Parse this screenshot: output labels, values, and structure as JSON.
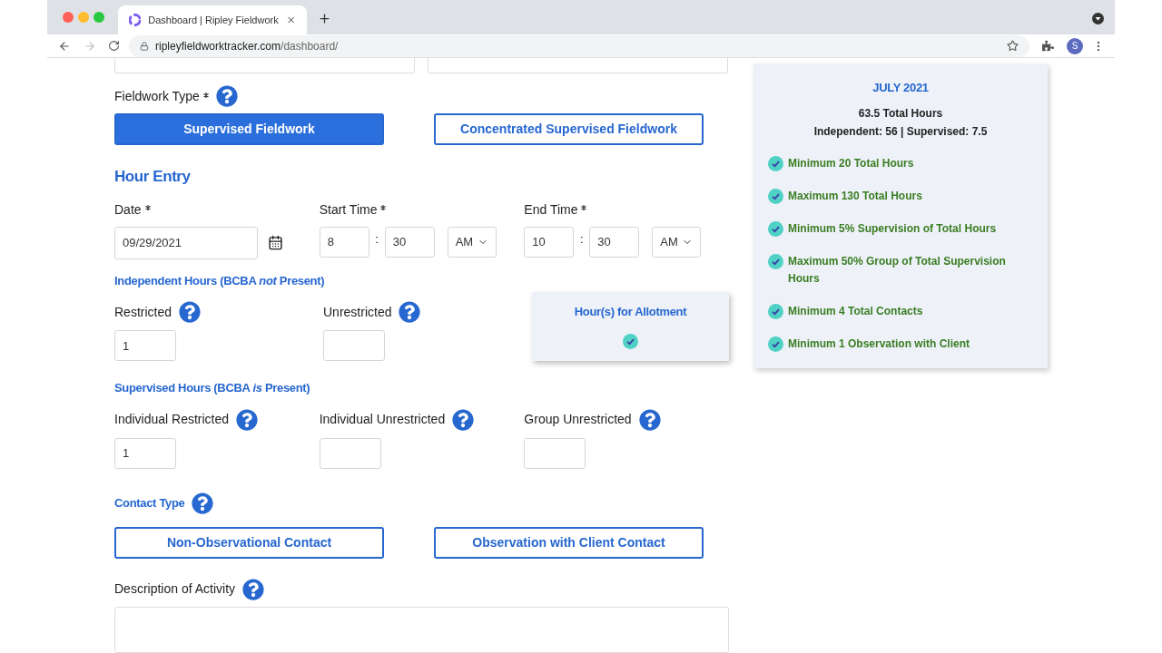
{
  "browser": {
    "tab_title": "Dashboard | Ripley Fieldwork",
    "url_domain": "ripleyfieldworktracker.com",
    "url_path": "/dashboard/",
    "profile_initial": "S"
  },
  "form": {
    "fieldwork_type": {
      "label": "Fieldwork Type",
      "required": true,
      "options": [
        {
          "label": "Supervised Fieldwork",
          "selected": true
        },
        {
          "label": "Concentrated Supervised Fieldwork",
          "selected": false
        }
      ]
    },
    "section_title": "Hour Entry",
    "date": {
      "label": "Date",
      "required": true,
      "value": "09/29/2021"
    },
    "start_time": {
      "label": "Start Time",
      "required": true,
      "hour": "8",
      "separator": ":",
      "minute": "30",
      "period": "AM"
    },
    "end_time": {
      "label": "End Time",
      "required": true,
      "hour": "10",
      "separator": ":",
      "minute": "30",
      "period": "AM"
    },
    "independent_heading": "Independent Hours (BCBA *not* Present)",
    "independent_fields": [
      {
        "label": "Restricted",
        "value": "1"
      },
      {
        "label": "Unrestricted"
      }
    ],
    "allotment": {
      "title": "Hour(s) for Allotment",
      "checked": true
    },
    "supervised_heading": "Supervised Hours (BCBA *is* Present)",
    "supervised_fields": [
      {
        "label": "Individual Restricted",
        "value": "1"
      },
      {
        "label": "Individual Unrestricted"
      },
      {
        "label": "Group Unrestricted"
      }
    ],
    "contact_type": {
      "label": "Contact Type",
      "options": [
        {
          "label": "Non-Observational Contact",
          "selected": false
        },
        {
          "label": "Observation with Client Contact",
          "selected": false
        }
      ]
    },
    "description": {
      "label": "Description of Activity"
    }
  },
  "summary": {
    "month": "JULY 2021",
    "total": "63.5 Total Hours",
    "breakdown": "Independent: 56 | Supervised: 7.5",
    "requirements": [
      {
        "label": "Minimum 20 Total Hours",
        "met": true
      },
      {
        "label": "Maximum 130 Total Hours",
        "met": true
      },
      {
        "label": "Minimum 5% Supervision of Total Hours",
        "met": true
      },
      {
        "label": "Maximum 50% Group of Total Supervision Hours",
        "met": true
      },
      {
        "label": "Minimum 4 Total Contacts",
        "met": true
      },
      {
        "label": "Minimum 1 Observation with Client",
        "met": true
      }
    ]
  }
}
